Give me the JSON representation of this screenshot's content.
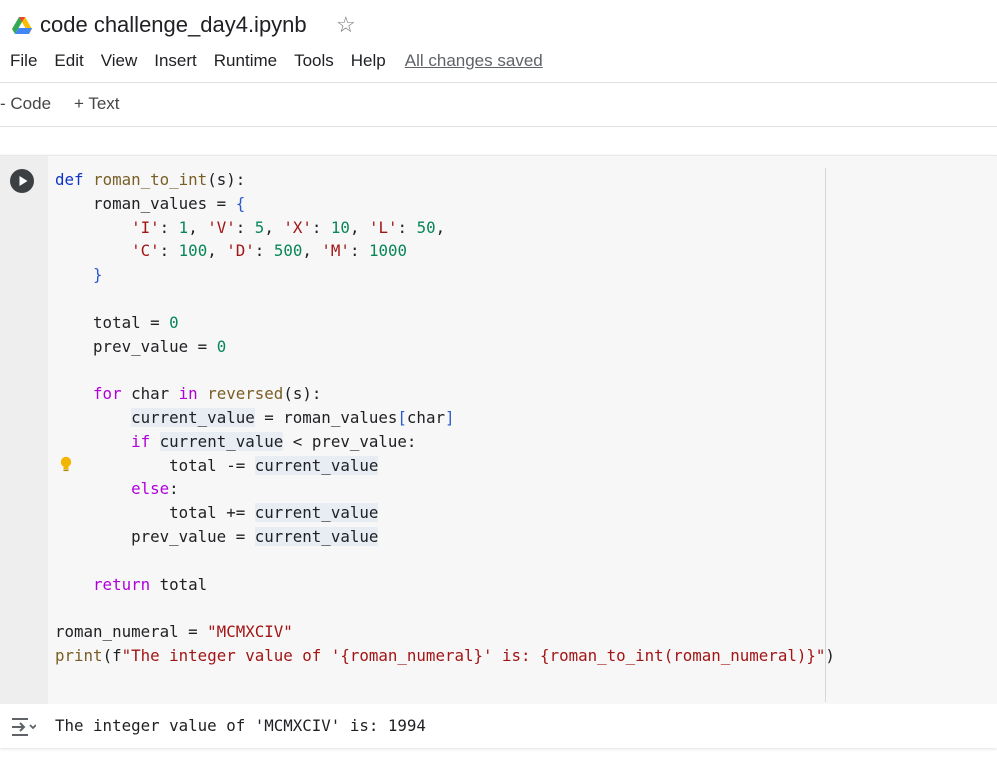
{
  "header": {
    "title": "code challenge_day4.ipynb",
    "star_icon": "star-outline-icon",
    "logo_icon": "google-drive-icon"
  },
  "menu": {
    "file": "File",
    "edit": "Edit",
    "view": "View",
    "insert": "Insert",
    "runtime": "Runtime",
    "tools": "Tools",
    "help": "Help",
    "status": "All changes saved"
  },
  "toolbar": {
    "code_label": "- Code",
    "text_label": "+ Text"
  },
  "cell": {
    "run_icon": "play-icon",
    "hint_icon": "lightbulb-icon",
    "lines": [
      "def roman_to_int(s):",
      "    roman_values = {",
      "        'I': 1, 'V': 5, 'X': 10, 'L': 50,",
      "        'C': 100, 'D': 500, 'M': 1000",
      "    }",
      "",
      "    total = 0",
      "    prev_value = 0",
      "",
      "    for char in reversed(s):",
      "        current_value = roman_values[char]",
      "        if current_value < prev_value:",
      "            total -= current_value",
      "        else:",
      "            total += current_value",
      "        prev_value = current_value",
      "",
      "    return total",
      "",
      "roman_numeral = \"MCMXCIV\"",
      "print(f\"The integer value of '{roman_numeral}' is: {roman_to_int(roman_numeral)}\")"
    ],
    "output_icon": "output-toggle-icon",
    "output": "The integer value of 'MCMXCIV' is: 1994"
  },
  "colors": {
    "keyword": "#0d34c3",
    "control": "#af00db",
    "function": "#795e26",
    "string": "#a31515",
    "number": "#098658",
    "editor_bg": "#f7f7f7",
    "gutter_bg": "#eeeeee"
  }
}
